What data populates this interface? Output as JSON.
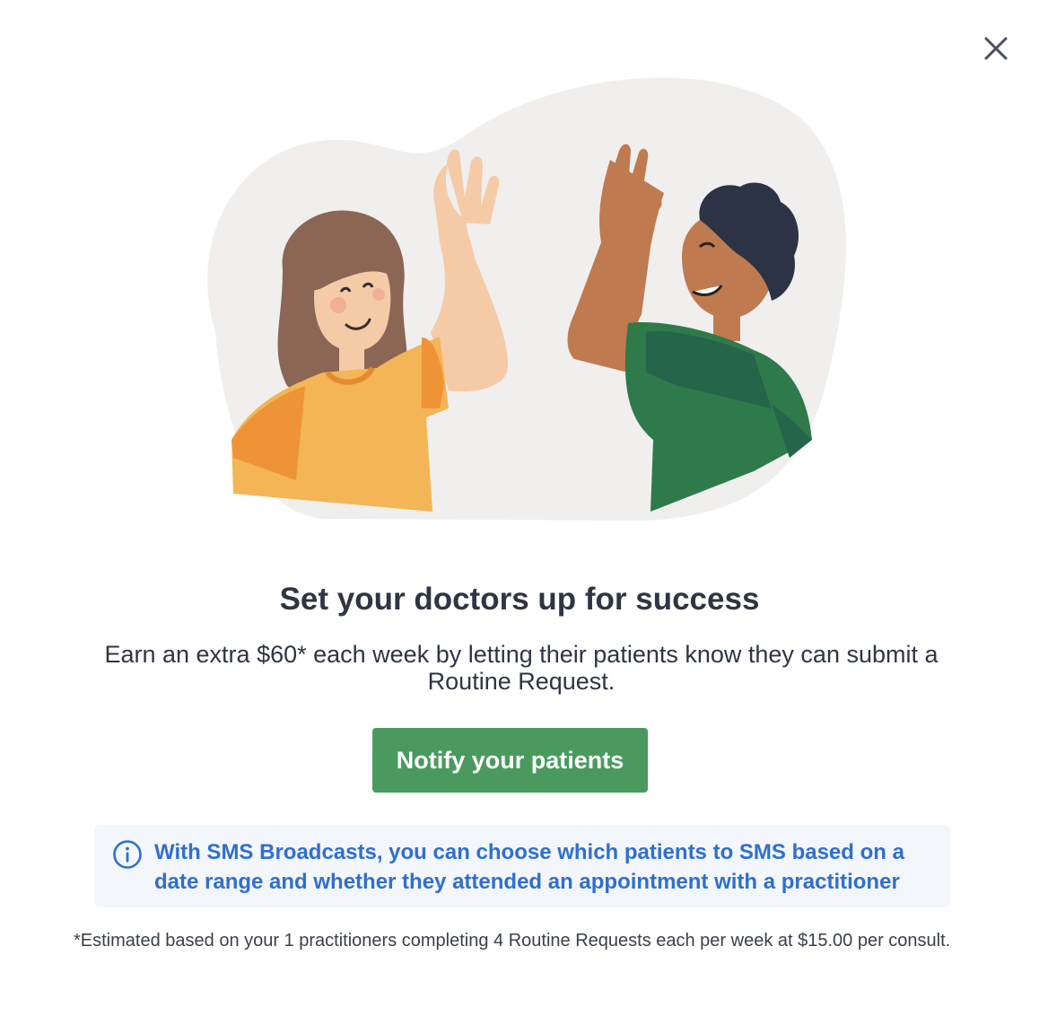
{
  "modal": {
    "close_icon": "close-icon",
    "illustration": "high-five-illustration",
    "title": "Set your doctors up for success",
    "subtitle": "Earn an extra $60* each week by letting their patients know they can submit a Routine Request.",
    "cta_label": "Notify your patients",
    "info": {
      "icon": "info-icon",
      "text": "With SMS Broadcasts, you can choose which patients to SMS based on a date range and whether they attended an appointment with a practitioner"
    },
    "footnote": "*Estimated based on your 1 practitioners completing 4 Routine Requests each per week at $15.00 per consult."
  },
  "colors": {
    "primary_button": "#4a9a5f",
    "info_text": "#2f6fd0",
    "info_background": "#f3f6fb",
    "heading_text": "#2f3542"
  }
}
